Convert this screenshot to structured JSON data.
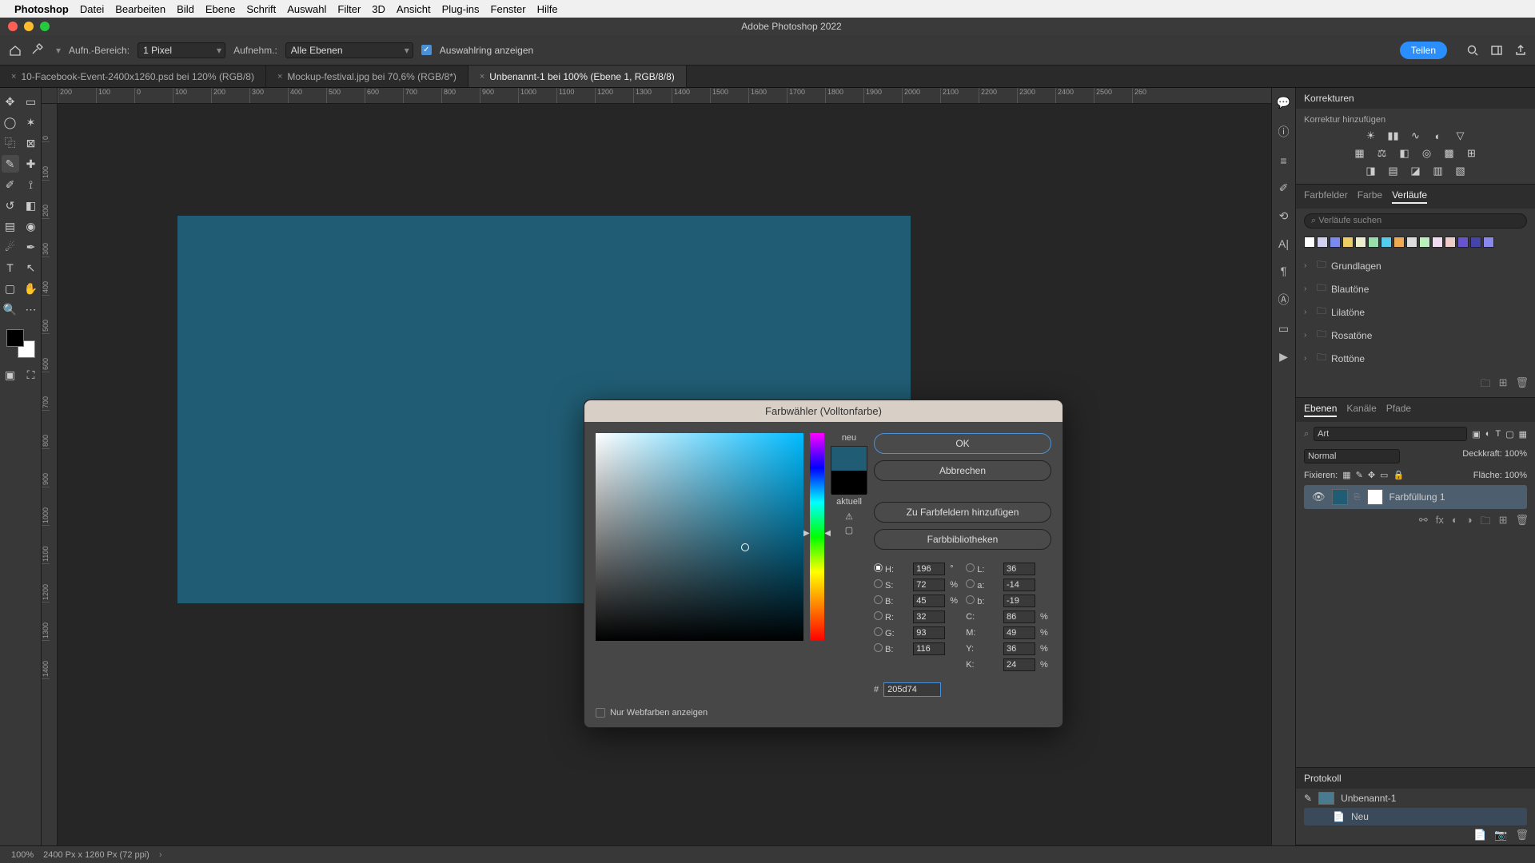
{
  "menubar": {
    "app": "Photoshop",
    "items": [
      "Datei",
      "Bearbeiten",
      "Bild",
      "Ebene",
      "Schrift",
      "Auswahl",
      "Filter",
      "3D",
      "Ansicht",
      "Plug-ins",
      "Fenster",
      "Hilfe"
    ]
  },
  "window_title": "Adobe Photoshop 2022",
  "options": {
    "range_label": "Aufn.-Bereich:",
    "range_value": "1 Pixel",
    "sample_label": "Aufnehm.:",
    "sample_value": "Alle Ebenen",
    "ring_label": "Auswahlring anzeigen",
    "share": "Teilen"
  },
  "tabs": [
    {
      "label": "10-Facebook-Event-2400x1260.psd bei 120% (RGB/8)",
      "active": false
    },
    {
      "label": "Mockup-festival.jpg bei 70,6% (RGB/8*)",
      "active": false
    },
    {
      "label": "Unbenannt-1 bei 100% (Ebene 1, RGB/8/8)",
      "active": true
    }
  ],
  "ruler_h": [
    "200",
    "100",
    "0",
    "100",
    "200",
    "300",
    "400",
    "500",
    "600",
    "700",
    "800",
    "900",
    "1000",
    "1100",
    "1200",
    "1300",
    "1400",
    "1500",
    "1600",
    "1700",
    "1800",
    "1900",
    "2000",
    "2100",
    "2200",
    "2300",
    "2400",
    "2500",
    "260"
  ],
  "ruler_v": [
    "0",
    "100",
    "200",
    "300",
    "400",
    "500",
    "600",
    "700",
    "800",
    "900",
    "1000",
    "1100",
    "1200",
    "1300",
    "1400"
  ],
  "canvas_color": "#205d74",
  "panels": {
    "adjustments": {
      "title": "Korrekturen",
      "add": "Korrektur hinzufügen"
    },
    "gradients": {
      "tabs": [
        "Farbfelder",
        "Farbe",
        "Verläufe"
      ],
      "search": "Verläufe suchen",
      "folders": [
        "Grundlagen",
        "Blautöne",
        "Lilatöne",
        "Rosatöne",
        "Rottöne"
      ]
    },
    "layers": {
      "tabs": [
        "Ebenen",
        "Kanäle",
        "Pfade"
      ],
      "kind": "Art",
      "blend": "Normal",
      "opacity_label": "Deckkraft:",
      "opacity_val": "100%",
      "lock_label": "Fixieren:",
      "fill_label": "Fläche:",
      "fill_val": "100%",
      "row_name": "Farbfüllung 1"
    },
    "history": {
      "title": "Protokoll",
      "doc": "Unbenannt-1",
      "step": "Neu"
    }
  },
  "dialog": {
    "title": "Farbwähler (Volltonfarbe)",
    "new": "neu",
    "current": "aktuell",
    "ok": "OK",
    "cancel": "Abbrechen",
    "add_swatch": "Zu Farbfeldern hinzufügen",
    "libs": "Farbbibliotheken",
    "web_only": "Nur Webfarben anzeigen",
    "H": "196",
    "S": "72",
    "Bv": "45",
    "L": "36",
    "a": "-14",
    "b": "-19",
    "R": "32",
    "G": "93",
    "Bc": "116",
    "C": "86",
    "M": "49",
    "Y": "36",
    "K": "24",
    "hex": "205d74"
  },
  "status": {
    "zoom": "100%",
    "dims": "2400 Px x 1260 Px (72 ppi)"
  },
  "swatch_colors": [
    "#ffffff",
    "#d0d0f0",
    "#7a8aee",
    "#eecc66",
    "#eeeecc",
    "#99ddaa",
    "#55ccee",
    "#eeaa55",
    "#dddddd",
    "#bceebb",
    "#eeddee",
    "#eecccc",
    "#6655cc",
    "#4444aa",
    "#8888ee"
  ]
}
